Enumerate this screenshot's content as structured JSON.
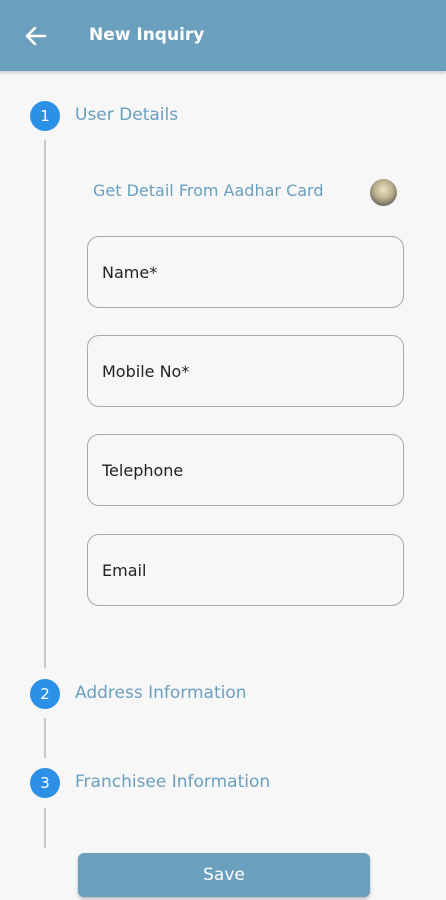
{
  "appbar": {
    "title": "New Inquiry",
    "back_icon": "arrow-left-icon"
  },
  "steps": [
    {
      "number": "1",
      "title": "User Details"
    },
    {
      "number": "2",
      "title": "Address Information"
    },
    {
      "number": "3",
      "title": "Franchisee Information"
    }
  ],
  "user_details": {
    "aadhar_link": "Get Detail From Aadhar Card",
    "aadhar_icon": "aadhar-logo-icon",
    "fields": [
      {
        "placeholder": "Name*",
        "value": ""
      },
      {
        "placeholder": "Mobile No*",
        "value": ""
      },
      {
        "placeholder": "Telephone",
        "value": ""
      },
      {
        "placeholder": "Email",
        "value": ""
      }
    ]
  },
  "actions": {
    "save_label": "Save"
  },
  "colors": {
    "primary": "#6a9fbe",
    "step_circle": "#2b90e6",
    "background": "#f7f7f8",
    "field_border": "#a8a8a8"
  }
}
